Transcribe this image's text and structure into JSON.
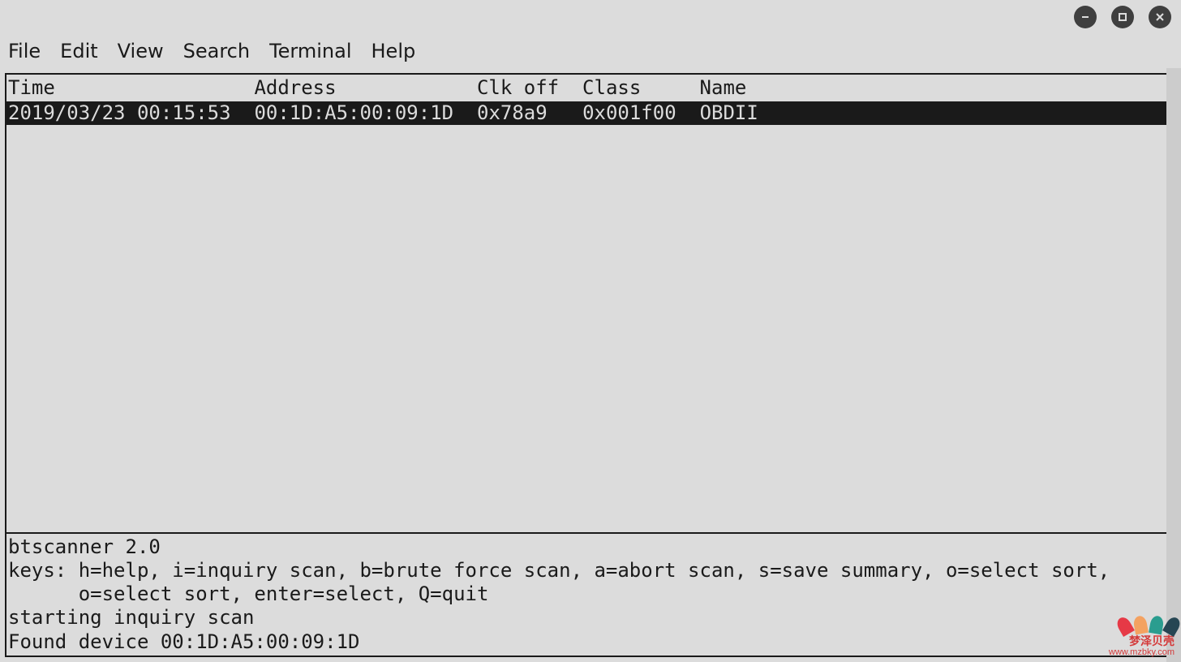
{
  "menubar": {
    "file": "File",
    "edit": "Edit",
    "view": "View",
    "search": "Search",
    "terminal": "Terminal",
    "help": "Help"
  },
  "panel": {
    "headers": {
      "time": "Time",
      "address": "Address",
      "clk_off": "Clk off",
      "class": "Class",
      "name": "Name"
    },
    "rows": [
      {
        "time": "2019/03/23 00:15:53",
        "address": "00:1D:A5:00:09:1D",
        "clk_off": "0x78a9",
        "class": "0x001f00",
        "name": "OBDII"
      }
    ]
  },
  "status": {
    "line1": "btscanner 2.0",
    "line2": "keys: h=help, i=inquiry scan, b=brute force scan, a=abort scan, s=save summary, o=select sort,",
    "line3": "      o=select sort, enter=select, Q=quit",
    "line4": "starting inquiry scan",
    "line5": "Found device 00:1D:A5:00:09:1D"
  },
  "watermark": {
    "text1": "梦泽贝壳",
    "text2": "www.mzbky.com"
  }
}
